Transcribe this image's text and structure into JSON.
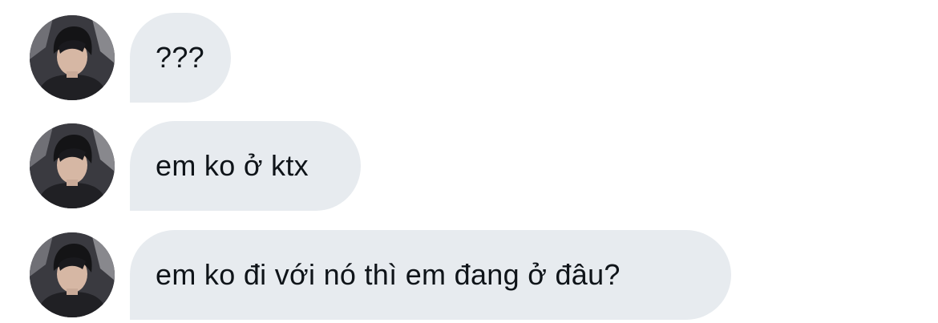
{
  "conversation": {
    "messages": [
      {
        "text": "???",
        "avatar_icon": "user-avatar"
      },
      {
        "text": "em ko ở ktx",
        "avatar_icon": "user-avatar"
      },
      {
        "text": "em ko đi với nó thì em đang ở đâu?",
        "avatar_icon": "user-avatar"
      }
    ]
  },
  "colors": {
    "bubble_background": "#e7ebef",
    "text": "#0f1419",
    "page_background": "#ffffff"
  }
}
